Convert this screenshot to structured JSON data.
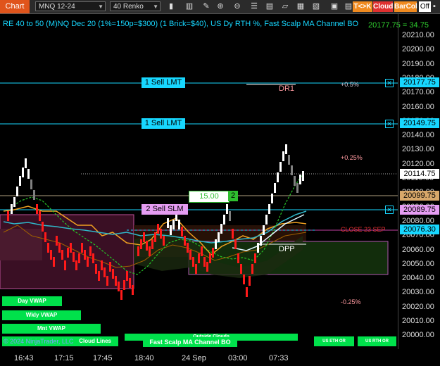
{
  "toolbar": {
    "chart_tab": "Chart",
    "instrument": "MNQ 12-24",
    "bar_type": "40 Renko",
    "tk_label": "T<>K",
    "cloud_label": "Cloud",
    "barcol_label": "BarCol",
    "off_label": "Off",
    "icons": [
      "bars-icon",
      "scroll-icon",
      "zoom-in-icon",
      "zoom-out-icon",
      "properties-icon",
      "drawing-icon",
      "templates-icon",
      "indicators-icon",
      "strategies-icon",
      "data-box-icon",
      "layout-icon"
    ]
  },
  "header": {
    "title": "RE 40 to 50 (M)NQ Dec 20 (1%=150p=$300) (1 Brick=$40), US Dy RTH %, Fast Scalp MA Channel BO",
    "top_right_value": "20177.75 = 34.75"
  },
  "price_axis": {
    "ticks": [
      "20210.00",
      "20200.00",
      "20190.00",
      "20180.00",
      "20170.00",
      "20160.00",
      "20150.00",
      "20140.00",
      "20130.00",
      "20120.00",
      "20110.00",
      "20100.00",
      "20090.00",
      "20080.00",
      "20070.00",
      "20060.00",
      "20050.00",
      "20040.00",
      "20030.00",
      "20020.00",
      "20010.00",
      "20000.00"
    ],
    "tags": [
      {
        "value": "20177.75",
        "bg": "#17d7ff"
      },
      {
        "value": "20149.75",
        "bg": "#17d7ff"
      },
      {
        "value": "20114.75",
        "bg": "#ffffff"
      },
      {
        "value": "20099.75",
        "bg": "#d8a86a"
      },
      {
        "value": "20089.75",
        "bg": "#e59cf2"
      },
      {
        "value": "20076.30",
        "bg": "#17d7ff"
      }
    ]
  },
  "orders": {
    "sell_lmt_1": "1 Sell LMT",
    "sell_lmt_2": "1 Sell LMT",
    "sell_slm": "2 Sell SLM",
    "qty_value": "15.00",
    "qty_count": "2",
    "close_x": "✕"
  },
  "labels": {
    "dr1": "DR1",
    "plus_half": "+0.5%",
    "plus_quarter": "+0.25%",
    "close_prev": "CLOSE 23 SEP",
    "dpp": "DPP",
    "minus_quarter": "-0.25%"
  },
  "buttons": {
    "day_vwap": "Day VWAP",
    "wkly_vwap": "Wkly VWAP",
    "mnt_vwap": "Mnt VWAP",
    "cloud_lines": "Cloud Lines",
    "outside_clouds": "Outside Clouds",
    "fast_scalp": "Fast Scalp MA Channel BO",
    "us_eth_or": "US ETH OR",
    "us_rth_or": "US RTH OR"
  },
  "watermark": "© 2024 NinjaTrader, LLC",
  "time_axis": [
    "16:43",
    "17:15",
    "17:45",
    "18:40",
    "24 Sep",
    "03:00",
    "07:33"
  ],
  "colors": {
    "accent": "#17d7ff",
    "up_brick": "#ffffff",
    "down_brick": "#ff1a1a",
    "green": "#00e14b"
  }
}
